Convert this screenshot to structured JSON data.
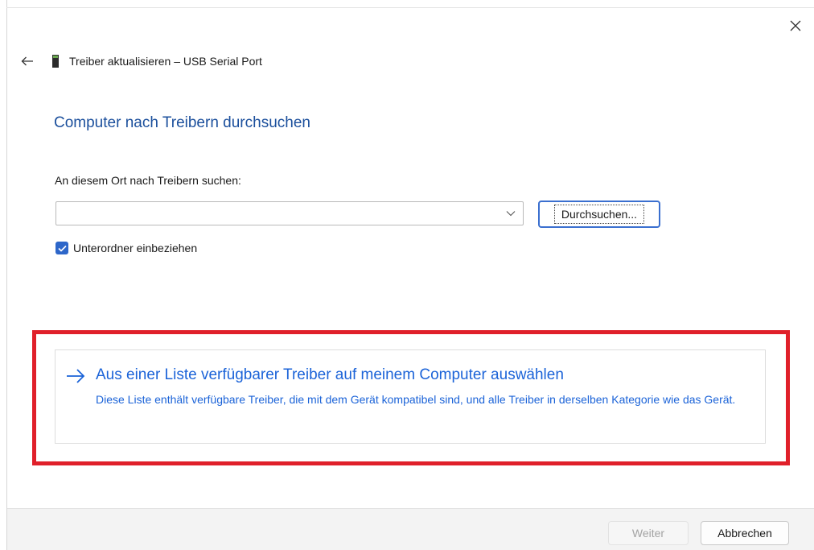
{
  "window": {
    "close_icon": "close-icon"
  },
  "header": {
    "back_icon": "arrow-left-icon",
    "device_icon": "usb-device-icon",
    "title": "Treiber aktualisieren – USB Serial Port"
  },
  "main": {
    "heading": "Computer nach Treibern durchsuchen",
    "location_label": "An diesem Ort nach Treibern suchen:",
    "path_value": "",
    "browse_label": "Durchsuchen...",
    "include_subfolders": {
      "label": "Unterordner einbeziehen",
      "checked": true
    }
  },
  "option": {
    "arrow_icon": "arrow-right-icon",
    "title": "Aus einer Liste verfügbarer Treiber auf meinem Computer auswählen",
    "description": "Diese Liste enthält verfügbare Treiber, die mit dem Gerät kompatibel sind, und alle Treiber in derselben Kategorie wie das Gerät."
  },
  "footer": {
    "next_label": "Weiter",
    "next_enabled": false,
    "cancel_label": "Abbrechen"
  },
  "colors": {
    "heading_blue": "#1b4f9c",
    "link_blue": "#1b63d8",
    "highlight_red": "#e0202a",
    "checkbox_blue": "#2d66c9"
  }
}
